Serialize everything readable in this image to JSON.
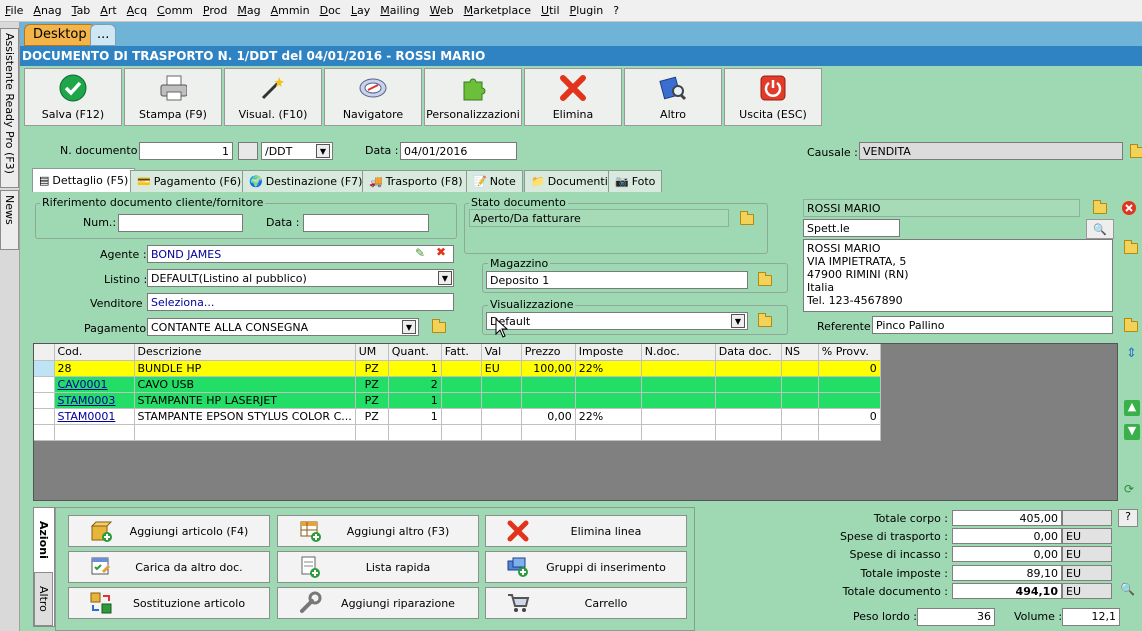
{
  "menu": [
    "File",
    "Anag",
    "Tab",
    "Art",
    "Acq",
    "Comm",
    "Prod",
    "Mag",
    "Ammin",
    "Doc",
    "Lay",
    "Mailing",
    "Web",
    "Marketplace",
    "Util",
    "Plugin",
    "?"
  ],
  "side_tabs": {
    "assistant": "Assistente Ready Pro (F3)",
    "news": "News"
  },
  "desktop_tabs": {
    "desktop": "Desktop",
    "more": "..."
  },
  "title": "DOCUMENTO DI TRASPORTO N. 1/DDT del 04/01/2016 - ROSSI MARIO",
  "toolbar": {
    "save": "Salva (F12)",
    "print": "Stampa (F9)",
    "view": "Visual. (F10)",
    "navigator": "Navigatore",
    "custom": "Personalizzazioni",
    "delete": "Elimina",
    "other": "Altro",
    "exit": "Uscita (ESC)"
  },
  "header": {
    "num_label": "N. documento :",
    "num_value": "1",
    "series_value": "/DDT",
    "date_label": "Data :",
    "date_value": "04/01/2016",
    "causale_label": "Causale :",
    "causale_value": "VENDITA"
  },
  "tabs": [
    "Dettaglio (F5)",
    "Pagamento (F6)",
    "Destinazione (F7)",
    "Trasporto (F8)",
    "Note",
    "Documenti",
    "Foto"
  ],
  "ref": {
    "title": "Riferimento documento cliente/fornitore",
    "num_label": "Num.:",
    "date_label": "Data :",
    "num_value": "",
    "date_value": ""
  },
  "status": {
    "title": "Stato documento",
    "value": "Aperto/Da fatturare"
  },
  "fields": {
    "agente_label": "Agente :",
    "agente_value": "BOND JAMES",
    "listino_label": "Listino :",
    "listino_value": "DEFAULT(Listino al pubblico)",
    "venditore_label": "Venditore :",
    "venditore_value": "Seleziona...",
    "pagamento_label": "Pagamento :",
    "pagamento_value": "CONTANTE ALLA CONSEGNA"
  },
  "magazzino": {
    "title": "Magazzino",
    "value": "Deposito 1"
  },
  "visual": {
    "title": "Visualizzazione",
    "value": "Default"
  },
  "customer": {
    "name": "ROSSI MARIO",
    "title": "Spett.le",
    "address": [
      "ROSSI MARIO",
      "VIA IMPIETRATA, 5",
      "47900 RIMINI (RN)",
      "Italia",
      "Tel. 123-4567890"
    ],
    "referente_label": "Referente",
    "referente_value": "Pinco Pallino"
  },
  "grid": {
    "columns": [
      "Cod.",
      "Descrizione",
      "UM",
      "Quant.",
      "Fatt.",
      "Val",
      "Prezzo",
      "Imposte",
      "N.doc.",
      "Data doc.",
      "NS",
      "% Provv."
    ],
    "rows": [
      {
        "cod": "28",
        "desc": "BUNDLE HP",
        "um": "PZ",
        "qty": "1",
        "fatt": "",
        "val": "EU",
        "price": "100,00",
        "tax": "22%",
        "ndoc": "",
        "date": "",
        "ns": "",
        "provv": "0",
        "color": "#ffff00"
      },
      {
        "cod": "CAV0001",
        "desc": "CAVO USB",
        "um": "PZ",
        "qty": "2",
        "fatt": "",
        "val": "",
        "price": "",
        "tax": "",
        "ndoc": "",
        "date": "",
        "ns": "",
        "provv": "",
        "color": "#22dd66"
      },
      {
        "cod": "STAM0003",
        "desc": "STAMPANTE HP LASERJET",
        "um": "PZ",
        "qty": "1",
        "fatt": "",
        "val": "",
        "price": "",
        "tax": "",
        "ndoc": "",
        "date": "",
        "ns": "",
        "provv": "",
        "color": "#22dd66"
      },
      {
        "cod": "STAM0001",
        "desc": "STAMPANTE EPSON STYLUS COLOR C...",
        "um": "PZ",
        "qty": "1",
        "fatt": "",
        "val": "",
        "price": "0,00",
        "tax": "22%",
        "ndoc": "",
        "date": "",
        "ns": "",
        "provv": "0",
        "color": "#ffffff"
      }
    ]
  },
  "bottom_tabs": {
    "azioni": "Azioni",
    "altro": "Altro"
  },
  "actions": {
    "add_article": "Aggiungi articolo (F4)",
    "add_other": "Aggiungi altro (F3)",
    "delete_line": "Elimina linea",
    "load_doc": "Carica da altro doc.",
    "quick_list": "Lista rapida",
    "insert_groups": "Gruppi di inserimento",
    "replace_article": "Sostituzione articolo",
    "add_repair": "Aggiungi riparazione",
    "cart": "Carrello"
  },
  "totals": {
    "corpo_label": "Totale corpo :",
    "corpo_value": "405,00",
    "trasporto_label": "Spese di trasporto :",
    "trasporto_value": "0,00",
    "trasporto_unit": "EU",
    "incasso_label": "Spese di incasso :",
    "incasso_value": "0,00",
    "incasso_unit": "EU",
    "imposte_label": "Totale imposte :",
    "imposte_value": "89,10",
    "imposte_unit": "EU",
    "documento_label": "Totale documento :",
    "documento_value": "494,10",
    "documento_unit": "EU",
    "peso_label": "Peso lordo :",
    "peso_value": "36",
    "volume_label": "Volume :",
    "volume_value": "12,1",
    "help": "?"
  }
}
